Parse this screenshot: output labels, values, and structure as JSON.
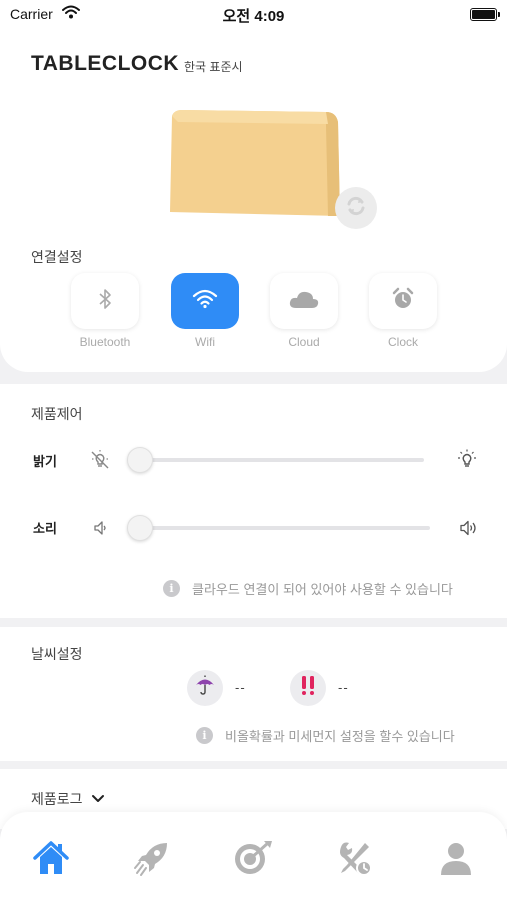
{
  "status_bar": {
    "carrier": "Carrier",
    "time": "오전 4:09"
  },
  "header": {
    "title": "TABLECLOCK",
    "timezone": "한국 표준시"
  },
  "connection": {
    "title": "연결설정",
    "options": [
      {
        "label": "Bluetooth",
        "icon": "bluetooth-icon",
        "active": false
      },
      {
        "label": "Wifi",
        "icon": "wifi-icon",
        "active": true
      },
      {
        "label": "Cloud",
        "icon": "cloud-icon",
        "active": false
      },
      {
        "label": "Clock",
        "icon": "alarm-clock-icon",
        "active": false
      }
    ],
    "accent_color": "#2f8cf6"
  },
  "control": {
    "title": "제품제어",
    "brightness_label": "밝기",
    "brightness_value": 0,
    "sound_label": "소리",
    "sound_value": 0,
    "info": "클라우드 연결이 되어 있어야 사용할 수 있습니다"
  },
  "weather": {
    "title": "날씨설정",
    "rain_value": "--",
    "dust_value": "--",
    "info": "비올확률과 미세먼지 설정을 할수 있습니다"
  },
  "log": {
    "title": "제품로그"
  },
  "tabs": [
    {
      "icon": "home-icon",
      "active": true
    },
    {
      "icon": "rocket-icon",
      "active": false
    },
    {
      "icon": "target-icon",
      "active": false
    },
    {
      "icon": "tools-icon",
      "active": false
    },
    {
      "icon": "user-icon",
      "active": false
    }
  ]
}
